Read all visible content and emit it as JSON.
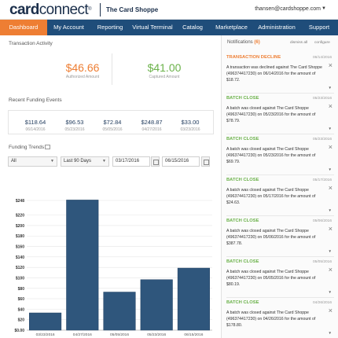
{
  "header": {
    "logo_left": "card",
    "logo_right": "connect",
    "logo_reg": "®",
    "shop_name": "The Card Shoppe",
    "user_email": "thansen@cardshoppe.com"
  },
  "nav": [
    {
      "label": "Dashboard",
      "active": true
    },
    {
      "label": "My Account",
      "active": false
    },
    {
      "label": "Reporting",
      "active": false
    },
    {
      "label": "Virtual Terminal",
      "active": false
    },
    {
      "label": "Catalog",
      "active": false
    },
    {
      "label": "Marketplace",
      "active": false
    },
    {
      "label": "Administration",
      "active": false
    },
    {
      "label": "Support",
      "active": false
    }
  ],
  "activity": {
    "title": "Transaction Activity",
    "authorized_amount": "$46.66",
    "authorized_label": "Authorized Amount",
    "captured_amount": "$41.00",
    "captured_label": "Captured Amount"
  },
  "funding_events": {
    "title": "Recent Funding Events",
    "items": [
      {
        "amount": "$118.64",
        "date": "06/14/2016"
      },
      {
        "amount": "$96.53",
        "date": "05/23/2016"
      },
      {
        "amount": "$72.84",
        "date": "05/05/2016"
      },
      {
        "amount": "$248.87",
        "date": "04/27/2016"
      },
      {
        "amount": "$33.00",
        "date": "03/23/2016"
      }
    ]
  },
  "funding_trends": {
    "title": "Funding Trends",
    "filter_all": "All",
    "filter_range": "Last 90 Days",
    "start_date": "03/17/2016",
    "end_date": "06/15/2016"
  },
  "chart_data": {
    "type": "bar",
    "categories": [
      "03/23/2016",
      "04/27/2016",
      "05/05/2016",
      "05/23/2016",
      "06/15/2016"
    ],
    "values": [
      33.0,
      248.87,
      72.84,
      96.53,
      118.64
    ],
    "ylim": [
      0,
      248
    ],
    "yticks": [
      "$0.00",
      "$20",
      "$40",
      "$60",
      "$80",
      "$100",
      "$120",
      "$140",
      "$160",
      "$180",
      "$200",
      "$220",
      "$248"
    ],
    "ytick_values": [
      0,
      20,
      40,
      60,
      80,
      100,
      120,
      140,
      160,
      180,
      200,
      220,
      248
    ],
    "bar_color": "#2f567c",
    "grid": true
  },
  "notifications": {
    "title": "Notifications",
    "count": "(6)",
    "dismiss_all": "dismiss all",
    "configure": "configure",
    "items": [
      {
        "type": "decline",
        "title": "TRANSACTION DECLINE",
        "date": "06/14/2016",
        "body": "A transaction was declined against The Card Shoppe (496374417230) on 06/14/2016 for the amount of $18.72."
      },
      {
        "type": "close",
        "title": "BATCH CLOSE",
        "date": "05/23/2016",
        "body": "A batch was closed against The Card Shoppe (496374417230) on 05/23/2016 for the amount of $78.79."
      },
      {
        "type": "close",
        "title": "BATCH CLOSE",
        "date": "05/23/2016",
        "body": "A batch was closed against The Card Shoppe (496374417230) on 05/23/2016 for the amount of $69.79."
      },
      {
        "type": "close",
        "title": "BATCH CLOSE",
        "date": "05/17/2016",
        "body": "A batch was closed against The Card Shoppe (496374417230) on 05/17/2016 for the amount of $24.63."
      },
      {
        "type": "close",
        "title": "BATCH CLOSE",
        "date": "05/06/2016",
        "body": "A batch was closed against The Card Shoppe (496374417230) on 05/06/2016 for the amount of $387.78."
      },
      {
        "type": "close",
        "title": "BATCH CLOSE",
        "date": "05/05/2016",
        "body": "A batch was closed against The Card Shoppe (496374417230) on 05/05/2016 for the amount of $80.19."
      },
      {
        "type": "close",
        "title": "BATCH CLOSE",
        "date": "04/26/2016",
        "body": "A batch was closed against The Card Shoppe (496374417230) on 04/26/2016 for the amount of $178.80."
      }
    ]
  },
  "colors": {
    "nav_bg": "#1f4d7a",
    "accent_orange": "#ee7e33",
    "accent_green": "#6bb24a",
    "bar": "#2f567c"
  }
}
